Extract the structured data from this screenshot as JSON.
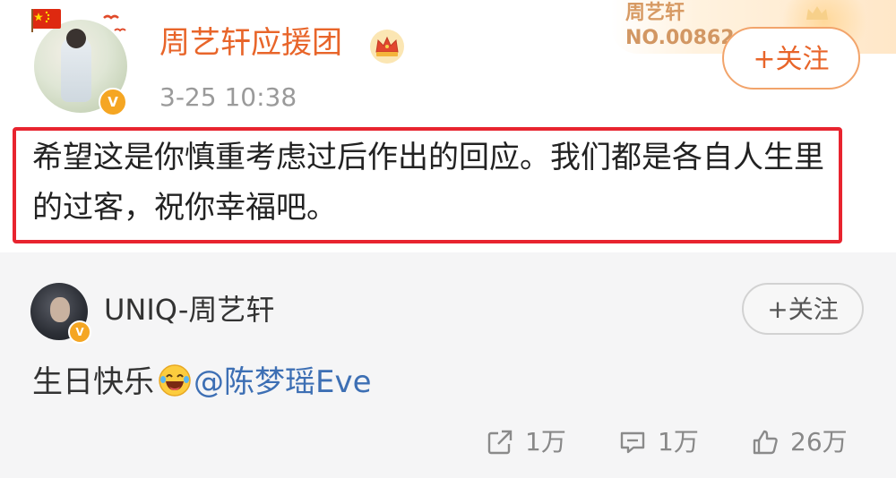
{
  "post": {
    "author": "周艺轩应援团",
    "time": "3-25 10:38",
    "text": "希望这是你慎重考虑过后作出的回应。我们都是各自人生里的过客，祝你幸福吧。",
    "follow_label": "+关注",
    "fan_card": {
      "name": "周艺轩",
      "number": "NO.00862"
    },
    "highlight_color": "#e8242f",
    "accent_color": "#e8652a"
  },
  "repost": {
    "author": "UNIQ-周艺轩",
    "follow_label": "+关注",
    "text": "生日快乐",
    "mention": "@陈梦瑶Eve",
    "mention_color": "#3d6fb4"
  },
  "actions": {
    "repost_count": "1万",
    "comment_count": "1万",
    "like_count": "26万"
  },
  "icons": {
    "verified": "V"
  }
}
